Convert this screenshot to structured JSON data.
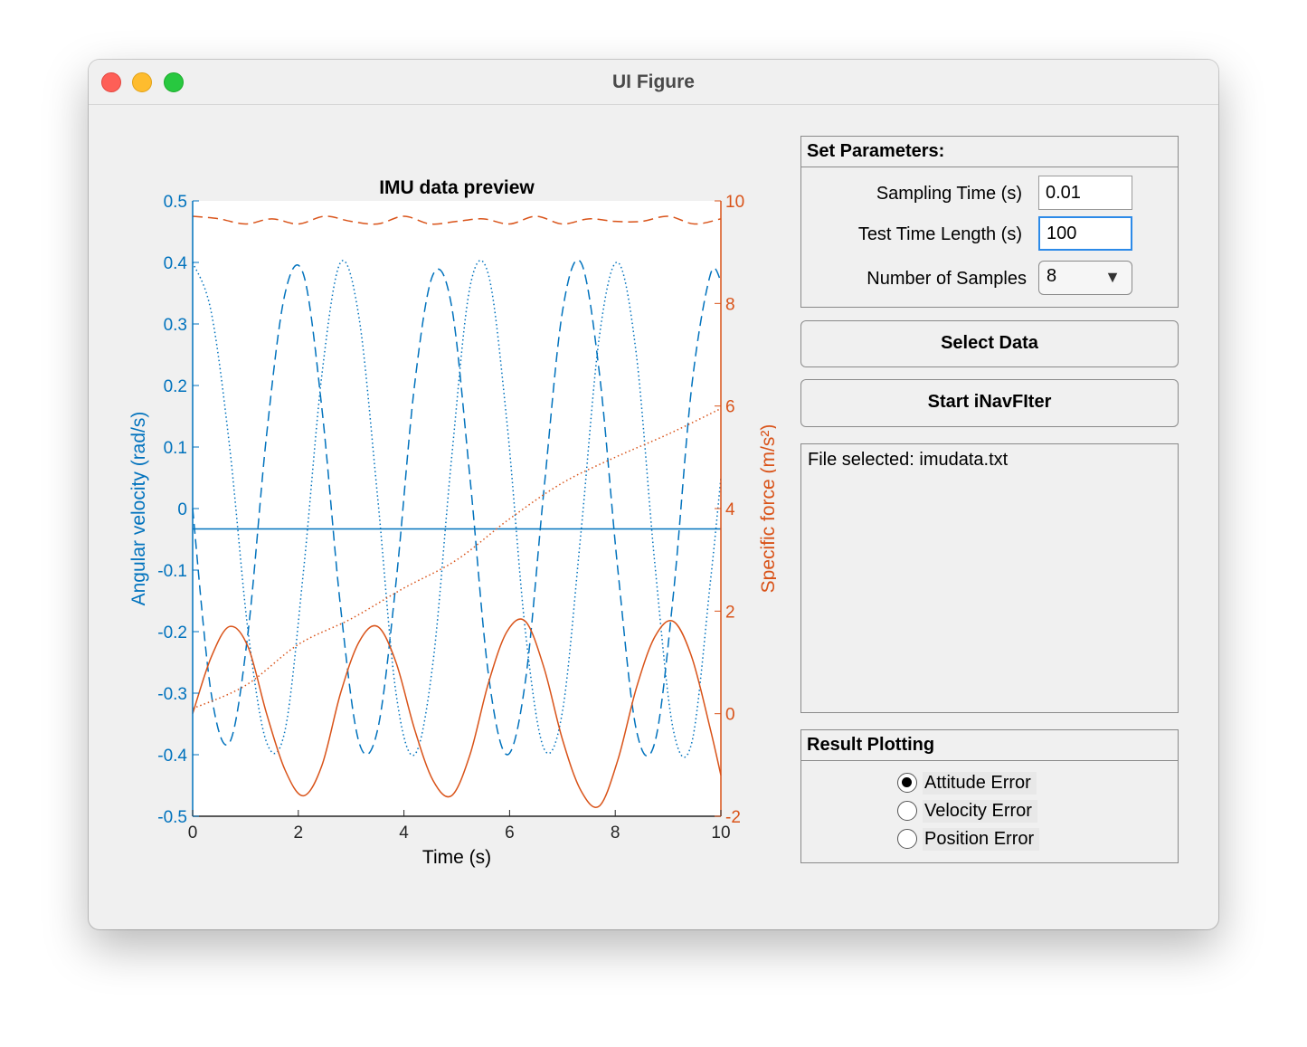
{
  "window": {
    "title": "UI Figure"
  },
  "chart_data": {
    "type": "line",
    "title": "IMU data preview",
    "xlabel": "Time (s)",
    "ylabel_left": "Angular velocity (rad/s)",
    "ylabel_right": "Specific force (m/s²)",
    "xlim": [
      0,
      10
    ],
    "ylim_left": [
      -0.5,
      0.5
    ],
    "ylim_right": [
      -2,
      10
    ],
    "xticks": [
      "0",
      "2",
      "4",
      "6",
      "8",
      "10"
    ],
    "yticks_left": [
      "0.5",
      "0.4",
      "0.3",
      "0.2",
      "0.1",
      "0",
      "-0.1",
      "-0.2",
      "-0.3",
      "-0.4",
      "-0.5"
    ],
    "yticks_right": [
      "10",
      "8",
      "6",
      "4",
      "2",
      "0",
      "-2"
    ],
    "grid": false,
    "colors": {
      "left": "#0072bd",
      "right": "#d95319"
    },
    "series": [
      {
        "axis": "left",
        "style": "dashed",
        "x": [
          0,
          0.35,
          0.7,
          1.05,
          1.4,
          1.75,
          2.1,
          2.45,
          2.8,
          3.15,
          3.5,
          3.85,
          4.2,
          4.55,
          4.9,
          5.25,
          5.6,
          5.95,
          6.3,
          6.65,
          7.0,
          7.35,
          7.7,
          8.05,
          8.4,
          8.75,
          9.1,
          9.45,
          9.8,
          10
        ],
        "y": [
          0.0,
          -0.3,
          -0.38,
          -0.2,
          0.12,
          0.35,
          0.38,
          0.16,
          -0.16,
          -0.38,
          -0.36,
          -0.12,
          0.2,
          0.38,
          0.33,
          0.05,
          -0.27,
          -0.4,
          -0.28,
          0.03,
          0.32,
          0.4,
          0.22,
          -0.1,
          -0.36,
          -0.38,
          -0.14,
          0.2,
          0.38,
          0.37
        ]
      },
      {
        "axis": "left",
        "style": "dotted",
        "x": [
          0,
          0.35,
          0.7,
          1.05,
          1.4,
          1.75,
          2.1,
          2.45,
          2.8,
          3.15,
          3.5,
          3.85,
          4.2,
          4.55,
          4.9,
          5.25,
          5.6,
          5.95,
          6.3,
          6.65,
          7.0,
          7.35,
          7.7,
          8.05,
          8.4,
          8.75,
          9.1,
          9.45,
          9.8,
          10
        ],
        "y": [
          0.4,
          0.32,
          0.1,
          -0.2,
          -0.38,
          -0.36,
          -0.1,
          0.22,
          0.4,
          0.31,
          0.02,
          -0.3,
          -0.4,
          -0.25,
          0.08,
          0.36,
          0.38,
          0.14,
          -0.2,
          -0.39,
          -0.33,
          -0.04,
          0.28,
          0.4,
          0.25,
          -0.09,
          -0.36,
          -0.38,
          -0.12,
          0.05
        ]
      },
      {
        "axis": "left",
        "style": "solid",
        "x": [
          0,
          10
        ],
        "y": [
          -0.033,
          -0.033
        ]
      },
      {
        "axis": "right",
        "style": "dashed",
        "x": [
          0,
          0.5,
          1.0,
          1.5,
          2.0,
          2.5,
          3.0,
          3.5,
          4.0,
          4.5,
          5.0,
          5.5,
          6.0,
          6.5,
          7.0,
          7.5,
          8.0,
          8.5,
          9.0,
          9.5,
          10
        ],
        "y": [
          9.7,
          9.65,
          9.55,
          9.65,
          9.55,
          9.7,
          9.6,
          9.55,
          9.7,
          9.55,
          9.6,
          9.65,
          9.55,
          9.7,
          9.55,
          9.65,
          9.6,
          9.6,
          9.7,
          9.55,
          9.65
        ]
      },
      {
        "axis": "right",
        "style": "dotted",
        "x": [
          0,
          1,
          2,
          3,
          4,
          5,
          6,
          7,
          8,
          9,
          10
        ],
        "y": [
          0.1,
          0.55,
          1.35,
          1.85,
          2.45,
          3.0,
          3.8,
          4.5,
          5.0,
          5.45,
          5.95
        ]
      },
      {
        "axis": "right",
        "style": "solid",
        "x": [
          0,
          0.35,
          0.7,
          1.05,
          1.4,
          1.75,
          2.1,
          2.45,
          2.8,
          3.15,
          3.5,
          3.85,
          4.2,
          4.55,
          4.9,
          5.25,
          5.6,
          5.95,
          6.3,
          6.65,
          7.0,
          7.35,
          7.7,
          8.05,
          8.4,
          8.75,
          9.1,
          9.45,
          9.8,
          10
        ],
        "y": [
          0.0,
          1.1,
          1.7,
          1.3,
          0.0,
          -1.1,
          -1.6,
          -1.0,
          0.4,
          1.4,
          1.7,
          1.0,
          -0.3,
          -1.3,
          -1.6,
          -0.8,
          0.6,
          1.6,
          1.8,
          0.9,
          -0.5,
          -1.5,
          -1.8,
          -0.9,
          0.5,
          1.5,
          1.8,
          1.1,
          -0.3,
          -1.2
        ]
      }
    ]
  },
  "params": {
    "title": "Set Parameters:",
    "sampling_label": "Sampling Time (s)",
    "sampling_value": "0.01",
    "length_label": "Test Time Length (s)",
    "length_value": "100",
    "samples_label": "Number of Samples",
    "samples_value": "8"
  },
  "buttons": {
    "select": "Select Data",
    "start": "Start iNavFIter"
  },
  "log": {
    "text": "File selected: imudata.txt"
  },
  "result": {
    "title": "Result Plotting",
    "options": [
      "Attitude Error",
      "Velocity Error",
      "Position Error"
    ],
    "selected": "Attitude Error"
  }
}
